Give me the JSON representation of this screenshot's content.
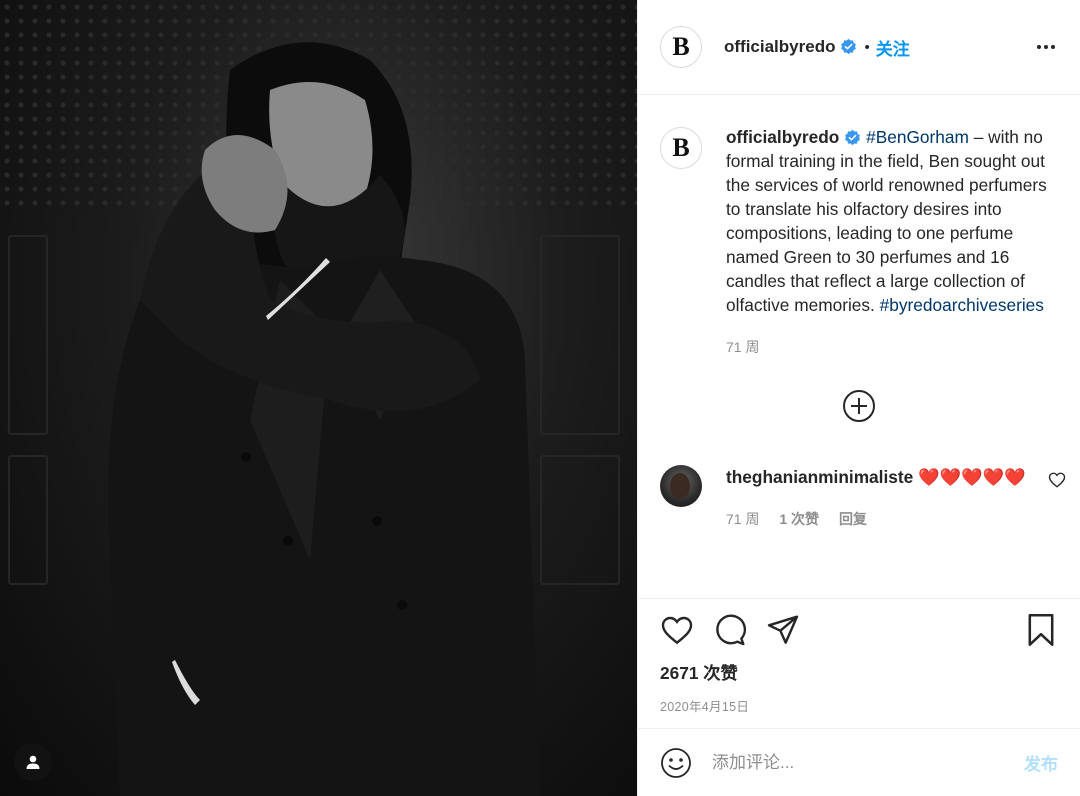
{
  "post": {
    "username": "officialbyredo",
    "avatar_letter": "B",
    "follow_label": "关注",
    "dot": "•",
    "caption_hashtag_1": "#BenGorham",
    "caption_body": " – with no formal training in the field, Ben sought out the services of world renowned perfumers to translate his olfactory desires into compositions, leading to one perfume named Green to 30 perfumes and 16 candles that reflect a large collection of olfactive memories. ",
    "caption_hashtag_2": "#byredoarchiveseries",
    "caption_time": "71 周",
    "likes": "2671 次赞",
    "date": "2020年4月15日"
  },
  "comment": {
    "username": "theghanianminimaliste",
    "text": "❤️❤️❤️❤️❤️",
    "time": "71 周",
    "likes": "1 次赞",
    "reply_label": "回复"
  },
  "comment_box": {
    "placeholder": "添加评论...",
    "post_label": "发布"
  },
  "icons": {
    "more": "more-options-icon",
    "verified": "verified-badge-icon",
    "load_more": "plus-circle-icon",
    "like": "heart-icon",
    "comment": "comment-bubble-icon",
    "share": "paper-plane-icon",
    "save": "bookmark-icon",
    "emoji": "smiley-icon",
    "tag": "user-tag-icon"
  },
  "colors": {
    "accent": "#0095f6",
    "hashtag": "#00376b",
    "muted": "#8e8e8e",
    "post_disabled": "#b2dffc"
  }
}
